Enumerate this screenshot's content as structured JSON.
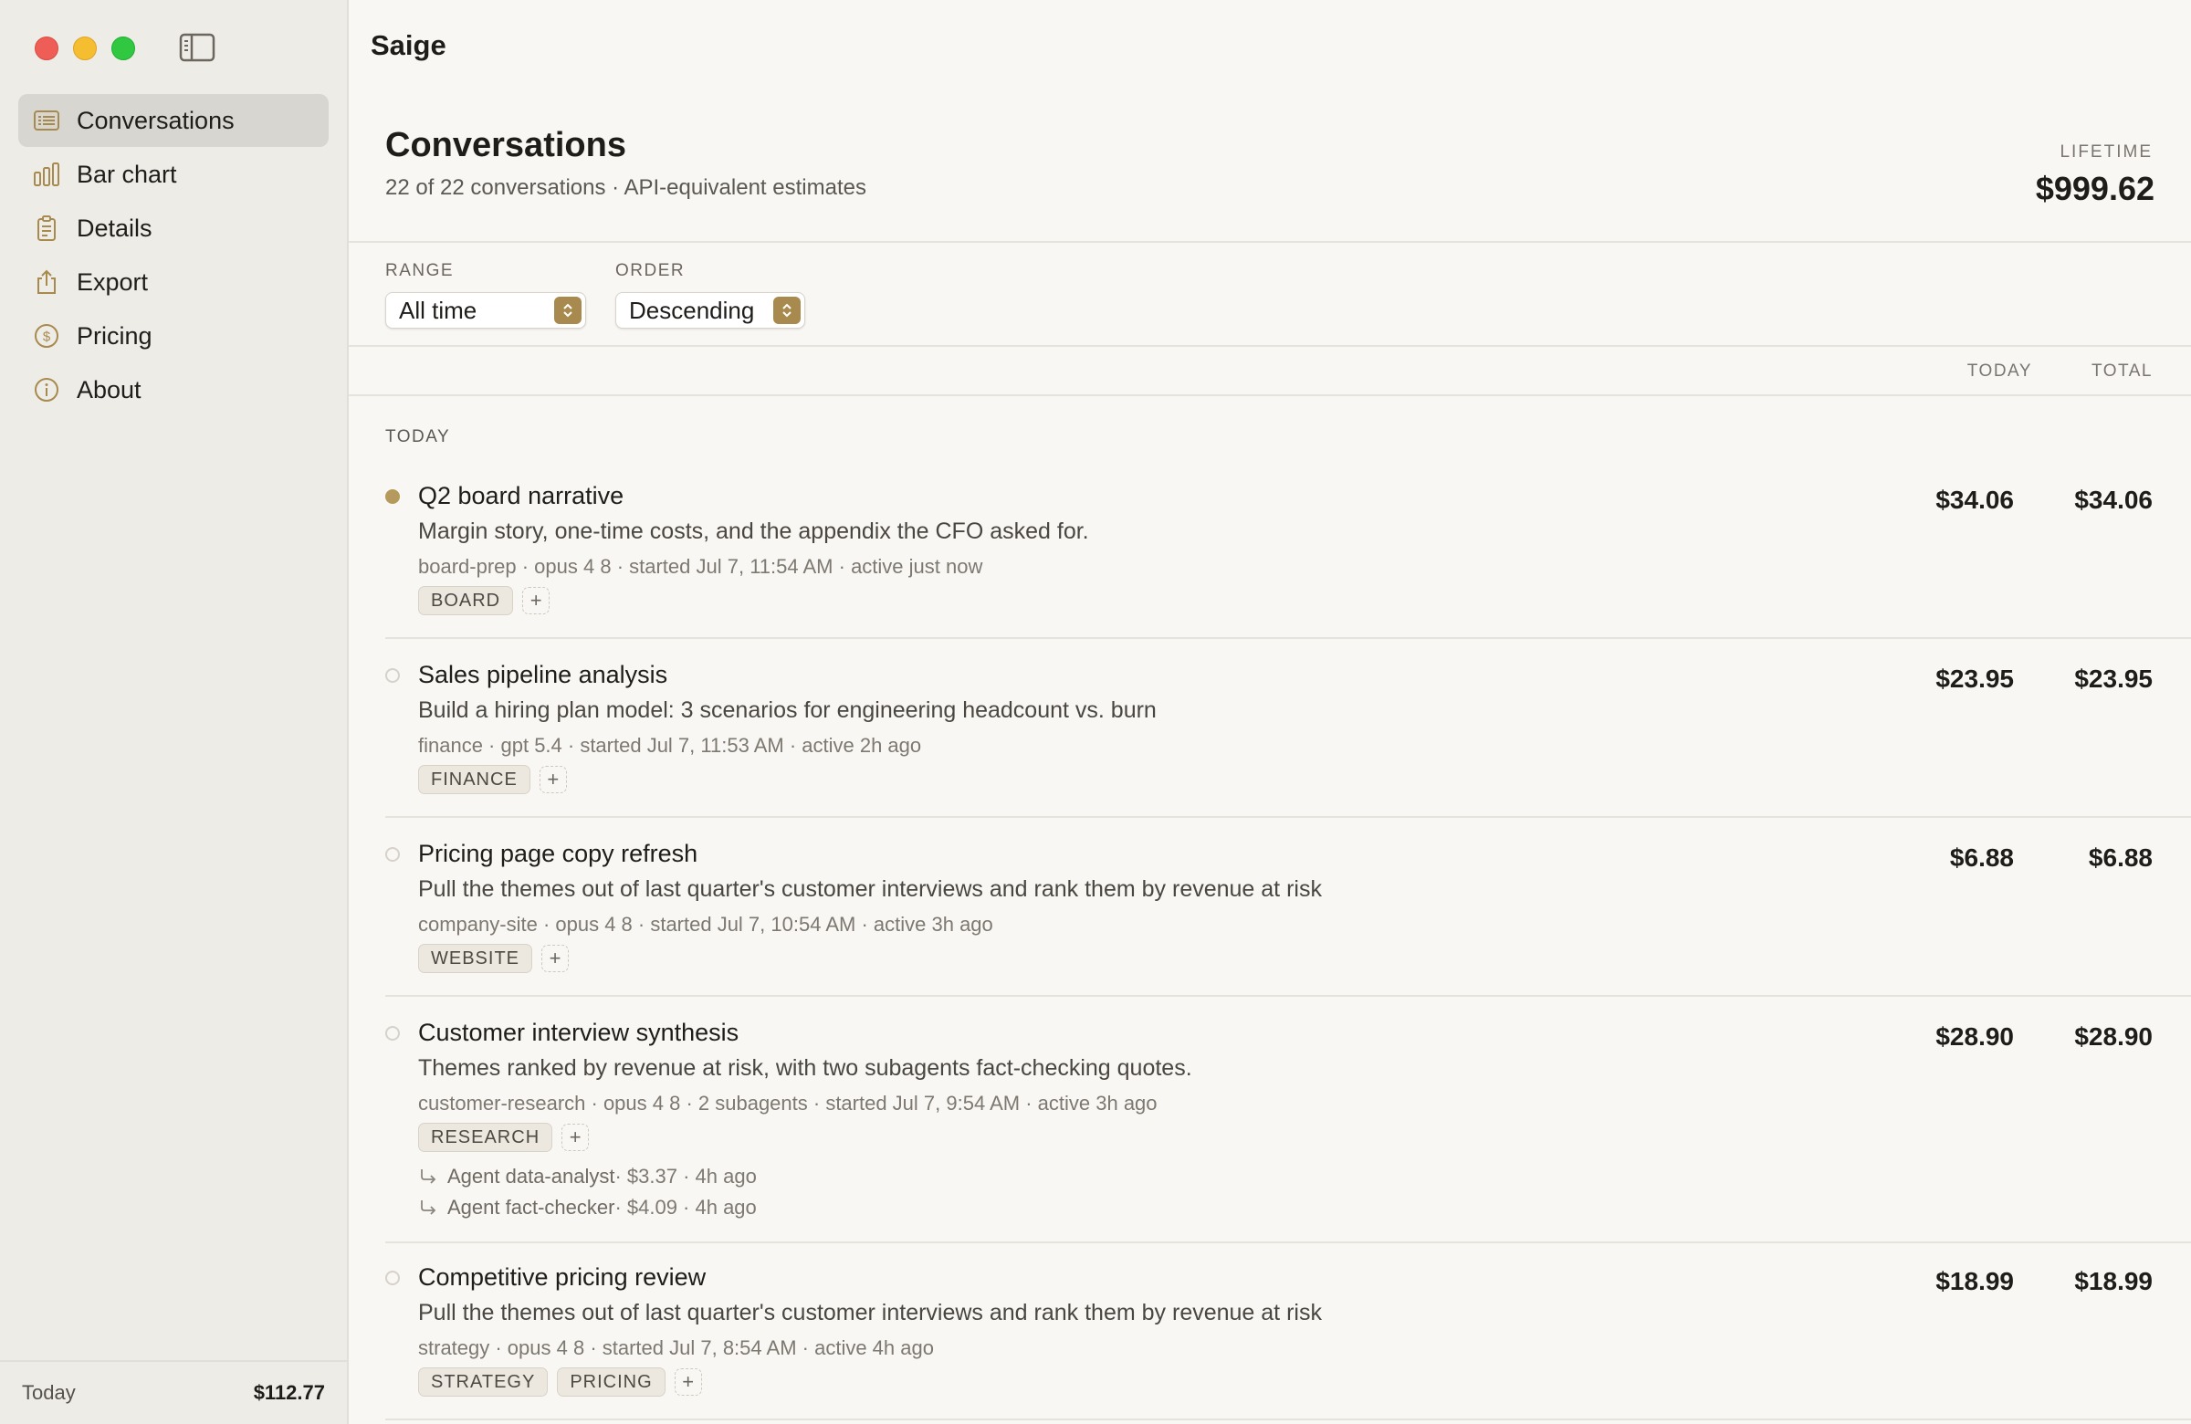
{
  "app": {
    "title": "Saige"
  },
  "sidebar": {
    "items": [
      {
        "label": "Conversations",
        "icon": "list-icon",
        "active": true
      },
      {
        "label": "Bar chart",
        "icon": "bar-chart-icon"
      },
      {
        "label": "Details",
        "icon": "clipboard-icon"
      },
      {
        "label": "Export",
        "icon": "share-icon"
      },
      {
        "label": "Pricing",
        "icon": "dollar-circle-icon"
      },
      {
        "label": "About",
        "icon": "info-circle-icon"
      }
    ],
    "footer": {
      "label": "Today",
      "value": "$112.77"
    }
  },
  "header": {
    "title": "Conversations",
    "subtitle": "22 of 22 conversations · API-equivalent estimates",
    "lifetime_label": "LIFETIME",
    "lifetime_value": "$999.62"
  },
  "filters": {
    "range": {
      "label": "RANGE",
      "value": "All time"
    },
    "order": {
      "label": "ORDER",
      "value": "Descending"
    }
  },
  "columns": {
    "today": "TODAY",
    "total": "TOTAL"
  },
  "section": {
    "label": "TODAY"
  },
  "conversations": [
    {
      "title": "Q2 board narrative",
      "description": "Margin story, one-time costs, and the appendix the CFO asked for.",
      "meta": "board-prep · opus 4 8 · started Jul 7, 11:54 AM · active just now",
      "tags": [
        "BOARD"
      ],
      "today": "$34.06",
      "total": "$34.06",
      "active": true
    },
    {
      "title": "Sales pipeline analysis",
      "description": "Build a hiring plan model: 3 scenarios for engineering headcount vs. burn",
      "meta": "finance · gpt 5.4 · started Jul 7, 11:53 AM · active 2h ago",
      "tags": [
        "FINANCE"
      ],
      "today": "$23.95",
      "total": "$23.95",
      "active": false
    },
    {
      "title": "Pricing page copy refresh",
      "description": "Pull the themes out of last quarter's customer interviews and rank them by revenue at risk",
      "meta": "company-site · opus 4 8 · started Jul 7, 10:54 AM · active 3h ago",
      "tags": [
        "WEBSITE"
      ],
      "today": "$6.88",
      "total": "$6.88",
      "active": false
    },
    {
      "title": "Customer interview synthesis",
      "description": "Themes ranked by revenue at risk, with two subagents fact-checking quotes.",
      "meta": "customer-research · opus 4 8 · 2 subagents · started Jul 7, 9:54 AM · active 3h ago",
      "tags": [
        "RESEARCH"
      ],
      "today": "$28.90",
      "total": "$28.90",
      "active": false,
      "agents": [
        {
          "name": "Agent data-analyst",
          "detail": " · $3.37 · 4h ago"
        },
        {
          "name": "Agent fact-checker",
          "detail": " · $4.09 · 4h ago"
        }
      ]
    },
    {
      "title": "Competitive pricing review",
      "description": "Pull the themes out of last quarter's customer interviews and rank them by revenue at risk",
      "meta": "strategy · opus 4 8 · started Jul 7, 8:54 AM · active 4h ago",
      "tags": [
        "STRATEGY",
        "PRICING"
      ],
      "today": "$18.99",
      "total": "$18.99",
      "active": false
    }
  ],
  "colors": {
    "accent": "#a88a4e",
    "active_dot": "#b59a5d",
    "sidebar_bg": "#eeece7",
    "main_bg": "#f8f7f4"
  }
}
